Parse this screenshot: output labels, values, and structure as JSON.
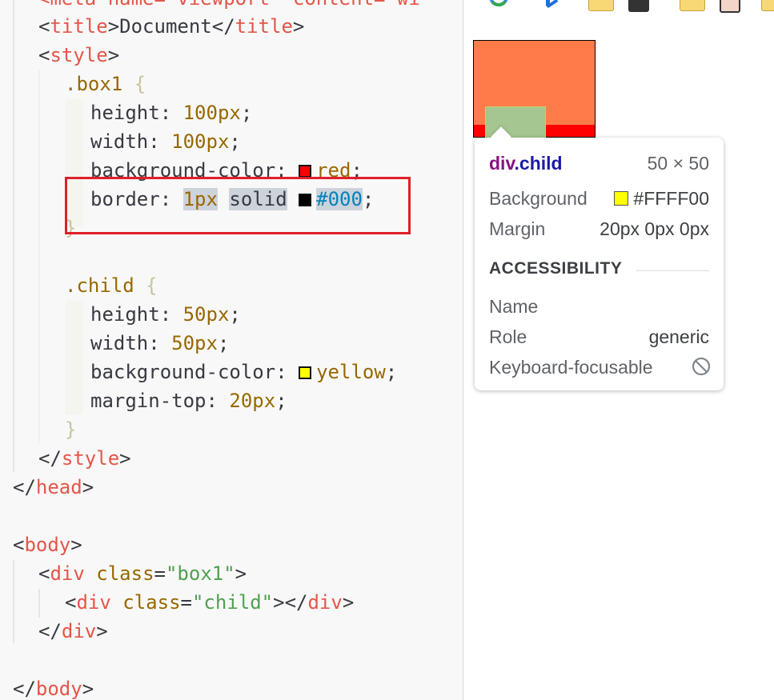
{
  "editor": {
    "lines": {
      "meta": "<meta name=\"viewport\" content=\"wi",
      "title_open": "<",
      "title_tag": "title",
      "title_gt": ">",
      "title_text": "Document",
      "title_close_lt": "</",
      "title_close_gt": ">",
      "style_tag": "style",
      "head_tag": "head",
      "body_tag": "body",
      "div_tag": "div",
      "class_attr": "class",
      "box1_str": "\"box1\"",
      "child_str": "\"child\"",
      "box1_sel": ".box1",
      "child_sel": ".child",
      "brace_open": "{",
      "brace_close": "}",
      "height": "height",
      "width": "width",
      "bgcolor": "background-color",
      "border": "border",
      "margintop": "margin-top",
      "v100": "100px",
      "v50": "50px",
      "v1": "1px",
      "solid": "solid",
      "hex000": "#000",
      "red": "red",
      "yellow": "yellow",
      "v20": "20px"
    }
  },
  "tooltip": {
    "selector_tag": "div",
    "selector_class": ".child",
    "size": "50 × 50",
    "background_label": "Background",
    "background_value": "#FFFF00",
    "margin_label": "Margin",
    "margin_value": "20px 0px 0px",
    "accessibility_heading": "ACCESSIBILITY",
    "name_label": "Name",
    "role_label": "Role",
    "role_value": "generic",
    "focusable_label": "Keyboard-focusable",
    "focusable_icon": "not-allowed-icon"
  },
  "colors": {
    "red_swatch": "#ff0000",
    "black_swatch": "#000000",
    "yellow_swatch": "#ffff00",
    "highlight_box": "#e0202b"
  }
}
